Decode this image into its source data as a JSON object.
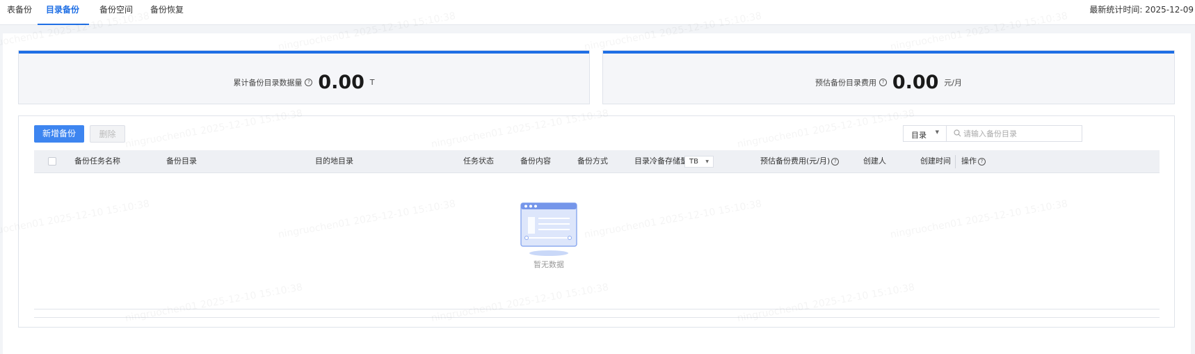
{
  "tabs": [
    {
      "label": "表备份",
      "active": false
    },
    {
      "label": "目录备份",
      "active": true
    },
    {
      "label": "备份空间",
      "active": false
    },
    {
      "label": "备份恢复",
      "active": false
    }
  ],
  "stat_time": "最新统计时间: 2025-12-09",
  "cards": [
    {
      "label": "累计备份目录数据量",
      "value": "0.00",
      "unit": "T"
    },
    {
      "label": "预估备份目录费用",
      "value": "0.00",
      "unit": "元/月"
    }
  ],
  "toolbar": {
    "add_label": "新增备份",
    "delete_label": "删除",
    "filter_selected": "目录",
    "search_placeholder": "请输入备份目录"
  },
  "table": {
    "columns": [
      "备份任务名称",
      "备份目录",
      "目的地目录",
      "任务状态",
      "备份内容",
      "备份方式",
      "目录冷备存储量",
      "预估备份费用(元/月)",
      "创建人",
      "创建时间",
      "操作"
    ],
    "storage_unit": "TB",
    "rows": [],
    "empty_text": "暂无数据"
  },
  "watermark": "ningruochen01 2025-12-10 15:10:38",
  "colors": {
    "accent": "#1f6fe5",
    "primary_button": "#3d85f0"
  }
}
